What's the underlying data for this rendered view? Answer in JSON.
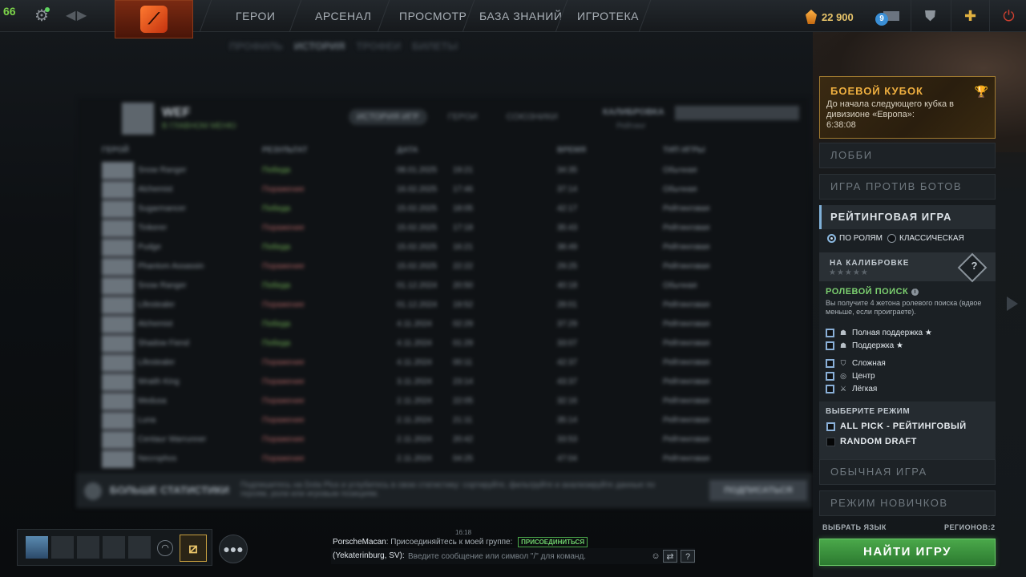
{
  "fps": "66",
  "nav": {
    "heroes": "ГЕРОИ",
    "arsenal": "АРСЕНАЛ",
    "watch": "ПРОСМОТР",
    "learn": "БАЗА ЗНАНИЙ",
    "arcade": "ИГРОТЕКА"
  },
  "currency": {
    "shards": "22 900"
  },
  "messages": {
    "count": "9"
  },
  "main": {
    "subnav": [
      "ПРОФИЛЬ",
      "ИСТОРИЯ",
      "ТРОФЕИ",
      "БИЛЕТЫ"
    ],
    "profile": {
      "name": "WEF",
      "status": "В ГЛАВНОМ МЕНЮ"
    },
    "tabs": [
      "ИСТОРИЯ ИГР",
      "ГЕРОИ",
      "СОЮЗНИКИ"
    ],
    "calibration": "КАЛИБРОВКА",
    "calibration_sub": "Рейтинг",
    "columns": [
      "ГЕРОЙ",
      "РЕЗУЛЬТАТ",
      "ДАТА",
      "ВРЕМЯ",
      "ТИП ИГРЫ"
    ],
    "matches": [
      {
        "hero": "Snow Ranger",
        "result": "Победа",
        "win": true,
        "date": "08.01.2025",
        "time": "19:21",
        "duration": "34:35",
        "type": "Обычная"
      },
      {
        "hero": "Alchemist",
        "result": "Поражение",
        "win": false,
        "date": "16.02.2025",
        "time": "17:46",
        "duration": "37:14",
        "type": "Обычная"
      },
      {
        "hero": "Sugarmancer",
        "result": "Победа",
        "win": true,
        "date": "15.02.2025",
        "time": "18:05",
        "duration": "42:17",
        "type": "Рейтинговая"
      },
      {
        "hero": "Tinkerer",
        "result": "Поражение",
        "win": false,
        "date": "15.02.2025",
        "time": "17:18",
        "duration": "35:43",
        "type": "Рейтинговая"
      },
      {
        "hero": "Pudge",
        "result": "Победа",
        "win": true,
        "date": "15.02.2025",
        "time": "16:21",
        "duration": "38:49",
        "type": "Рейтинговая"
      },
      {
        "hero": "Phantom Assassin",
        "result": "Поражение",
        "win": false,
        "date": "15.02.2025",
        "time": "22:22",
        "duration": "29:25",
        "type": "Рейтинговая"
      },
      {
        "hero": "Snow Ranger",
        "result": "Победа",
        "win": true,
        "date": "01.12.2024",
        "time": "20:50",
        "duration": "40:18",
        "type": "Обычная"
      },
      {
        "hero": "Lifestealer",
        "result": "Поражение",
        "win": false,
        "date": "01.12.2024",
        "time": "19:52",
        "duration": "28:01",
        "type": "Рейтинговая"
      },
      {
        "hero": "Alchemist",
        "result": "Победа",
        "win": true,
        "date": "4.11.2024",
        "time": "02:29",
        "duration": "37:29",
        "type": "Рейтинговая"
      },
      {
        "hero": "Shadow Fiend",
        "result": "Победа",
        "win": true,
        "date": "4.11.2024",
        "time": "01:29",
        "duration": "33:07",
        "type": "Рейтинговая"
      },
      {
        "hero": "Lifestealer",
        "result": "Поражение",
        "win": false,
        "date": "4.11.2024",
        "time": "00:11",
        "duration": "42:37",
        "type": "Рейтинговая"
      },
      {
        "hero": "Wraith King",
        "result": "Поражение",
        "win": false,
        "date": "3.11.2024",
        "time": "23:14",
        "duration": "43:37",
        "type": "Рейтинговая"
      },
      {
        "hero": "Medusa",
        "result": "Поражение",
        "win": false,
        "date": "2.11.2024",
        "time": "22:05",
        "duration": "32:16",
        "type": "Рейтинговая"
      },
      {
        "hero": "Luna",
        "result": "Поражение",
        "win": false,
        "date": "2.11.2024",
        "time": "21:11",
        "duration": "35:14",
        "type": "Рейтинговая"
      },
      {
        "hero": "Centaur Warrunner",
        "result": "Поражение",
        "win": false,
        "date": "2.11.2024",
        "time": "20:42",
        "duration": "33:53",
        "type": "Рейтинговая"
      },
      {
        "hero": "Necrophos",
        "result": "Поражение",
        "win": false,
        "date": "2.11.2024",
        "time": "04:25",
        "duration": "47:04",
        "type": "Рейтинговая"
      }
    ],
    "stats_title": "БОЛЬШЕ СТАТИСТИКИ",
    "stats_desc": "Подпишитесь на Dota Plus и углубитесь в свою статистику: сортируйте, фильтруйте и анализируйте данные по героям, роли или игровым позициям.",
    "stats_button": "ПОДПИСАТЬСЯ"
  },
  "right": {
    "cup": {
      "title": "БОЕВОЙ КУБОК",
      "desc": "До начала следующего кубка в дивизионе «Европа»:",
      "timer": "6:38:08"
    },
    "lobby": "ЛОББИ",
    "bots": "ИГРА ПРОТИВ БОТОВ",
    "ranked": {
      "title": "РЕЙТИНГОВАЯ ИГРА",
      "by_roles": "ПО РОЛЯМ",
      "classic": "КЛАССИЧЕСКАЯ",
      "calib_title": "НА КАЛИБРОВКЕ",
      "calib_stars": "★★★★★",
      "calib_q": "?",
      "role_search": "РОЛЕВОЙ ПОИСК",
      "role_desc": "Вы получите 4 жетона ролевого поиска (вдвое меньше, если проиграете).",
      "roles": [
        {
          "label": "Полная поддержка ★",
          "icon": "hard-support-icon"
        },
        {
          "label": "Поддержка ★",
          "icon": "support-icon"
        },
        {
          "label": "Сложная",
          "icon": "offlane-icon"
        },
        {
          "label": "Центр",
          "icon": "mid-icon"
        },
        {
          "label": "Лёгкая",
          "icon": "carry-icon"
        }
      ],
      "choose_mode": "ВЫБЕРИТЕ РЕЖИМ",
      "modes": [
        "ALL PICK - РЕЙТИНГОВЫЙ",
        "RANDOM DRAFT"
      ]
    },
    "normal": "ОБЫЧНАЯ ИГРА",
    "newbie": "РЕЖИМ НОВИЧКОВ",
    "lang": "ВЫБРАТЬ ЯЗЫК",
    "regions": "РЕГИОНОВ:2",
    "find": "НАЙТИ ИГРУ"
  },
  "chat": {
    "time": "16:18",
    "user": "PorscheMacan",
    "message": "Присоединяйтесь к моей группе:",
    "join": "ПРИСОЕДИНИТЬСЯ",
    "channel": "(Yekaterinburg, SV):",
    "placeholder": "Введите сообщение или символ \"/\" для команд."
  }
}
